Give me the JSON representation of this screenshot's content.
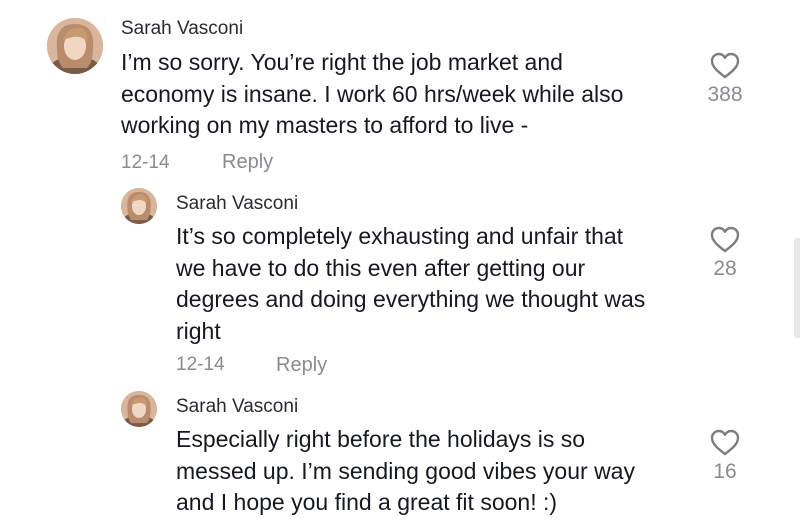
{
  "comments": [
    {
      "author": "Sarah Vasconi",
      "lines": [
        "I’m so sorry. You’re right the job market and",
        "economy is insane. I work 60 hrs/week while also",
        "working on my masters to afford to live -"
      ],
      "date": "12-14",
      "reply_label": "Reply",
      "likes": "388",
      "avatar_icon": "profile-photo"
    },
    {
      "author": "Sarah Vasconi",
      "lines": [
        "It’s so completely exhausting and unfair that",
        "we have to do this even after getting our",
        "degrees and doing everything we thought was",
        "right"
      ],
      "date": "12-14",
      "reply_label": "Reply",
      "likes": "28",
      "avatar_icon": "profile-photo"
    },
    {
      "author": "Sarah Vasconi",
      "lines": [
        "Especially right before the holidays is so",
        "messed up. I’m sending good vibes your way",
        "and I hope you find a great fit soon! :)"
      ],
      "likes": "16",
      "avatar_icon": "profile-photo"
    }
  ],
  "icons": {
    "like": "heart-outline-icon"
  },
  "colors": {
    "text": "#161823",
    "muted": "#8a8b91"
  }
}
